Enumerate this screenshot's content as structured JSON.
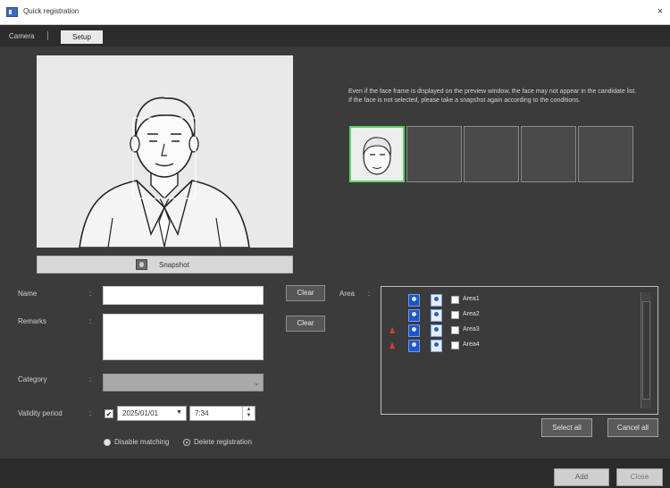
{
  "window": {
    "title": "Quick registration",
    "close_glyph": "×"
  },
  "mode_tabs": {
    "camera": "Camera",
    "setup": "Setup"
  },
  "snapshot": {
    "label": "Snapshot",
    "icon": "person-snapshot-icon"
  },
  "instructions": "Even if the face frame is displayed on the preview window, the face may not appear in the candidate list. If the face is not selected, please take a snapshot again according to the conditions.",
  "form": {
    "name_label": "Name",
    "remarks_label": "Remarks",
    "category_label": "Category",
    "validity_label": "Validity period",
    "colon": ":",
    "clear_label": "Clear",
    "area_label": "Area",
    "date_value": "2025/01/01",
    "time_value": "7:34",
    "validity_checked": true,
    "disable_matching": "Disable matching",
    "delete_registration": "Delete registration"
  },
  "areas": [
    {
      "label": "Area1",
      "alert": false
    },
    {
      "label": "Area2",
      "alert": false
    },
    {
      "label": "Area3",
      "alert": true
    },
    {
      "label": "Area4",
      "alert": true
    }
  ],
  "area_buttons": {
    "select_all": "Select all",
    "cancel_all": "Cancel all"
  },
  "footer": {
    "add": "Add",
    "close": "Close"
  },
  "colors": {
    "accent_green": "#5fd16a",
    "alert_red": "#e03a3a",
    "person_blue": "#1f56c4"
  }
}
